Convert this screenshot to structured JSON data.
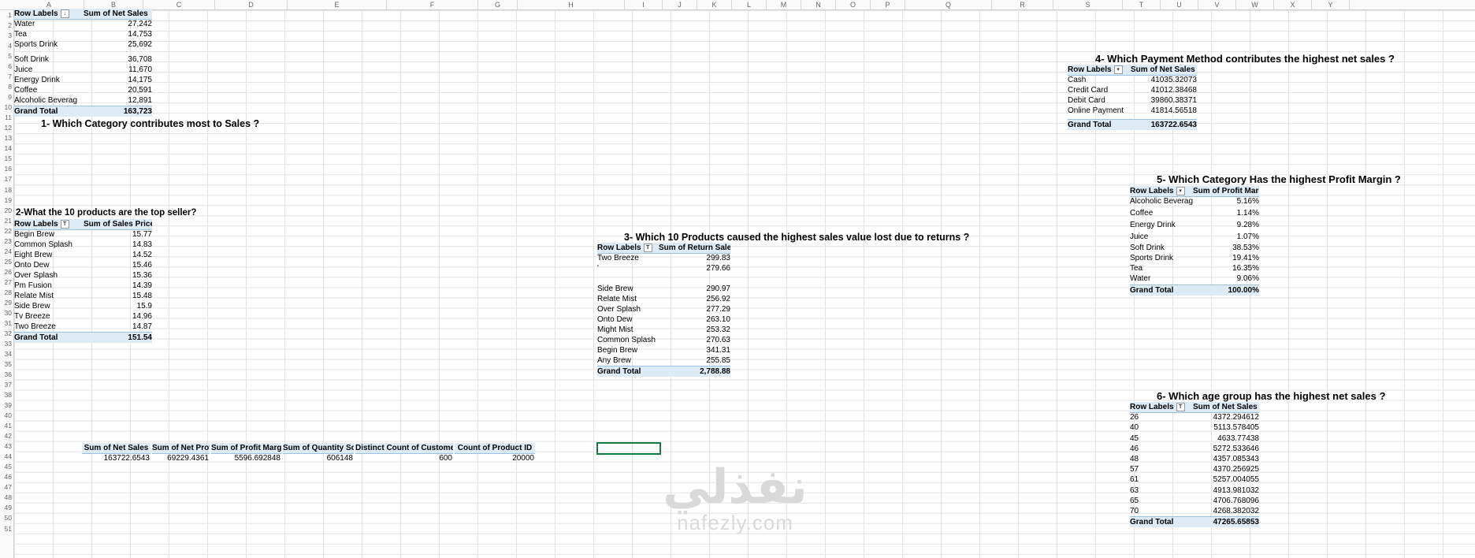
{
  "columns": [
    "A",
    "B",
    "C",
    "D",
    "E",
    "F",
    "G",
    "H",
    "I",
    "J",
    "K",
    "L",
    "M",
    "N",
    "O",
    "P",
    "Q",
    "R",
    "S",
    "T",
    "U",
    "V",
    "W",
    "X",
    "Y"
  ],
  "rows": [
    "1",
    "2",
    "3",
    "4",
    "5",
    "6",
    "7",
    "8",
    "9",
    "10",
    "11",
    "12",
    "13",
    "14",
    "15",
    "16",
    "17",
    "18",
    "19",
    "20",
    "21",
    "22",
    "23",
    "24",
    "25",
    "26",
    "27",
    "28",
    "29",
    "30",
    "31",
    "32",
    "33",
    "34",
    "35",
    "36",
    "37",
    "38",
    "39",
    "40",
    "41",
    "42",
    "43",
    "44",
    "45",
    "46",
    "47",
    "48",
    "49",
    "50",
    "51"
  ],
  "q1": {
    "title": "1-   Which Category contributes most to Sales ?",
    "h1": "Row Labels",
    "h2": "Sum of Net Sales",
    "filter": "↓",
    "rows": [
      [
        "Water",
        "27,242"
      ],
      [
        "Tea",
        "14,753"
      ],
      [
        "Sports Drink",
        "25,692"
      ],
      [
        "Soft Drink",
        "36,708"
      ],
      [
        "Juice",
        "11,670"
      ],
      [
        "Energy Drink",
        "14,175"
      ],
      [
        "Coffee",
        "20,591"
      ],
      [
        "Alcoholic Beverag",
        "12,891"
      ]
    ],
    "total": [
      "Grand Total",
      "163,723"
    ]
  },
  "q2": {
    "title": "2-What the 10 products are the top seller?",
    "h1": "Row Labels",
    "h2": "Sum of Sales Price",
    "filter": "T",
    "rows": [
      [
        "Begin Brew",
        "15.77"
      ],
      [
        "Common Splash",
        "14.83"
      ],
      [
        "Eight Brew",
        "14.52"
      ],
      [
        "Onto Dew",
        "15.46"
      ],
      [
        "Over Splash",
        "15.36"
      ],
      [
        "Pm Fusion",
        "14.39"
      ],
      [
        "Relate Mist",
        "15.48"
      ],
      [
        "Side Brew",
        "15.9"
      ],
      [
        "Tv Breeze",
        "14.96"
      ],
      [
        "Two Breeze",
        "14.87"
      ]
    ],
    "total": [
      "Grand Total",
      "151.54"
    ]
  },
  "q3": {
    "title": "3-   Which 10 Products caused the highest sales value lost due to returns ?",
    "h1": "Row Labels",
    "h2": "Sum of Return Sales Value",
    "filter": "T",
    "rows": [
      [
        "Two Breeze",
        "299.83"
      ],
      [
        "'",
        "279.66"
      ],
      [
        "Side Brew",
        "290.97"
      ],
      [
        "Relate Mist",
        "256.92"
      ],
      [
        "Over Splash",
        "277.29"
      ],
      [
        "Onto Dew",
        "263.10"
      ],
      [
        "Might Mist",
        "253.32"
      ],
      [
        "Common Splash",
        "270.63"
      ],
      [
        "Begin Brew",
        "341.31"
      ],
      [
        "Any Brew",
        "255.85"
      ]
    ],
    "total": [
      "Grand Total",
      "2,788.88"
    ]
  },
  "q4": {
    "title": "4-  Which Payment Method contributes the highest net sales ?",
    "h1": "Row Labels",
    "h2": "Sum of Net Sales",
    "filter": "▾",
    "rows": [
      [
        "Cash",
        "41035.32073"
      ],
      [
        "Credit Card",
        "41012.38468"
      ],
      [
        "Debit Card",
        "39860.38371"
      ],
      [
        "Online Payment",
        "41814.56518"
      ]
    ],
    "total": [
      "Grand Total",
      "163722.6543"
    ]
  },
  "q5": {
    "title": "5-  Which Category Has the highest Profit Margin ?",
    "h1": "Row Labels",
    "h2": "Sum of Profit Margin",
    "filter": "▾",
    "rows": [
      [
        "Alcoholic Beverag",
        "5.16%"
      ],
      [
        "Coffee",
        "1.14%"
      ],
      [
        "Energy Drink",
        "9.28%"
      ],
      [
        "Juice",
        "1.07%"
      ],
      [
        "Soft Drink",
        "38.53%"
      ],
      [
        "Sports Drink",
        "19.41%"
      ],
      [
        "Tea",
        "16.35%"
      ],
      [
        "Water",
        "9.06%"
      ]
    ],
    "total": [
      "Grand Total",
      "100.00%"
    ]
  },
  "q6": {
    "title": "6-  Which age group has the highest net sales ?",
    "h1": "Row Labels",
    "h2": "Sum of Net Sales",
    "filter": "T",
    "rows": [
      [
        "26",
        "4372.294612"
      ],
      [
        "40",
        "5113.578405"
      ],
      [
        "45",
        "4633.77438"
      ],
      [
        "46",
        "5272.533646"
      ],
      [
        "48",
        "4357.085343"
      ],
      [
        "57",
        "4370.256925"
      ],
      [
        "61",
        "5257.004055"
      ],
      [
        "63",
        "4913.981032"
      ],
      [
        "65",
        "4706.768096"
      ],
      [
        "70",
        "4268.382032"
      ]
    ],
    "total": [
      "Grand Total",
      "47265.65853"
    ]
  },
  "kpi": {
    "headers": [
      "Sum of Net Sales",
      "Sum of Net Profit",
      "Sum of Profit Margin",
      "Sum of Quantity Sold",
      "Distinct Count of Customer ID",
      "Count of Product ID"
    ],
    "values": [
      "163722.6543",
      "69229.4361",
      "5596.692848",
      "606148",
      "600",
      "20000"
    ]
  },
  "watermark": {
    "arabic": "نفذلي",
    "latin": "nafezly.com"
  }
}
